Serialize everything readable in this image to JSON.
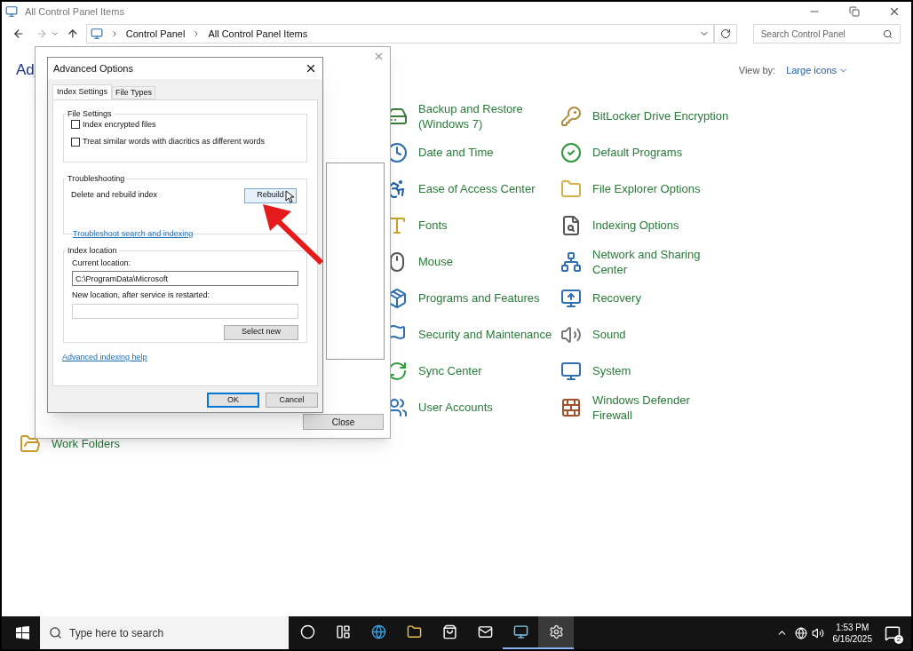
{
  "window": {
    "title": "All Control Panel Items"
  },
  "address_bar": {
    "path": [
      "Control Panel",
      "All Control Panel Items"
    ]
  },
  "search": {
    "placeholder": "Search Control Panel"
  },
  "heading": "Adj",
  "view_by": {
    "label": "View by:",
    "value": "Large icons"
  },
  "columns": [
    [
      {
        "lines": [
          "Work Folders"
        ]
      }
    ],
    [
      {
        "lines": [
          "Backup and Restore",
          "(Windows 7)"
        ]
      },
      {
        "lines": [
          "Date and Time"
        ]
      },
      {
        "lines": [
          "Ease of Access Center"
        ]
      },
      {
        "lines": [
          "Fonts"
        ]
      },
      {
        "lines": [
          "Mouse"
        ]
      },
      {
        "lines": [
          "Programs and Features"
        ]
      },
      {
        "lines": [
          "Security and Maintenance"
        ]
      },
      {
        "lines": [
          "Sync Center"
        ]
      },
      {
        "lines": [
          "User Accounts"
        ]
      }
    ],
    [
      {
        "lines": [
          "BitLocker Drive Encryption"
        ]
      },
      {
        "lines": [
          "Default Programs"
        ]
      },
      {
        "lines": [
          "File Explorer Options"
        ]
      },
      {
        "lines": [
          "Indexing Options"
        ]
      },
      {
        "lines": [
          "Network and Sharing",
          "Center"
        ]
      },
      {
        "lines": [
          "Recovery"
        ]
      },
      {
        "lines": [
          "Sound"
        ]
      },
      {
        "lines": [
          "System"
        ]
      },
      {
        "lines": [
          "Windows Defender",
          "Firewall"
        ]
      }
    ]
  ],
  "indexing_dialog": {
    "close_button": "Close"
  },
  "advanced_dialog": {
    "title": "Advanced Options",
    "tabs": [
      {
        "label": "Index Settings",
        "selected": true
      },
      {
        "label": "File Types",
        "selected": false
      }
    ],
    "file_settings": {
      "title": "File Settings",
      "options": [
        {
          "label": "Index encrypted files",
          "checked": false
        },
        {
          "label": "Treat similar words with diacritics as different words",
          "checked": false
        }
      ]
    },
    "troubleshooting": {
      "title": "Troubleshooting",
      "label": "Delete and rebuild index",
      "button": "Rebuild",
      "link": "Troubleshoot search and indexing"
    },
    "index_location": {
      "title": "Index location",
      "current_label": "Current location:",
      "current_value": "C:\\ProgramData\\Microsoft",
      "new_label": "New location, after service is restarted:",
      "button": "Select new"
    },
    "help_link": "Advanced indexing help",
    "buttons": [
      "OK",
      "Cancel"
    ]
  },
  "taskbar": {
    "search_placeholder": "Type here to search",
    "apps": [
      {
        "open": false,
        "focused": false
      },
      {
        "open": false,
        "focused": false
      },
      {
        "open": false,
        "focused": false
      },
      {
        "open": false,
        "focused": false
      },
      {
        "open": true,
        "focused": false
      },
      {
        "open": true,
        "focused": true
      }
    ],
    "time": "1:53 PM",
    "date": "6/16/2025",
    "notifications": "2"
  }
}
